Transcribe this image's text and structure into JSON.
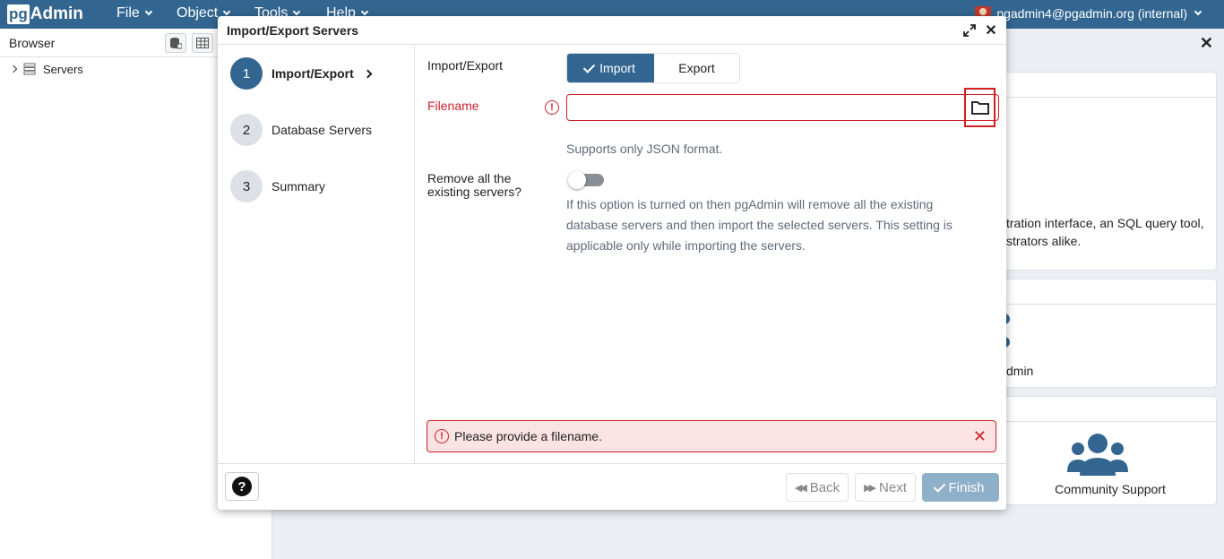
{
  "navbar": {
    "logo_pg": "pg",
    "logo_admin": "Admin",
    "menus": [
      "File",
      "Object",
      "Tools",
      "Help"
    ],
    "user": "pgadmin4@pgadmin.org (internal)",
    "color": "#326690"
  },
  "browser": {
    "title": "Browser",
    "tree": [
      {
        "label": "Servers"
      }
    ]
  },
  "dashboard": {
    "intro_line1": "tration interface, an SQL query tool,",
    "intro_line2": "strators alike.",
    "partial_label": "dmin",
    "community_support": "Community Support"
  },
  "dialog": {
    "title": "Import/Export Servers",
    "steps": [
      {
        "number": "1",
        "label": "Import/Export"
      },
      {
        "number": "2",
        "label": "Database Servers"
      },
      {
        "number": "3",
        "label": "Summary"
      }
    ],
    "import_export_label": "Import/Export",
    "import_label": "Import",
    "export_label": "Export",
    "filename_label": "Filename",
    "filename_value": "",
    "filename_help": "Supports only JSON format.",
    "remove_label_line1": "Remove all the",
    "remove_label_line2": "existing servers?",
    "remove_help_line1": "If this option is turned on then pgAdmin will remove all the existing",
    "remove_help_line2": "database servers and then import the selected servers. This setting is",
    "remove_help_line3": "applicable only while importing the servers.",
    "error_message": "Please provide a filename.",
    "footer": {
      "help": "?",
      "back": "Back",
      "next": "Next",
      "finish": "Finish"
    }
  }
}
